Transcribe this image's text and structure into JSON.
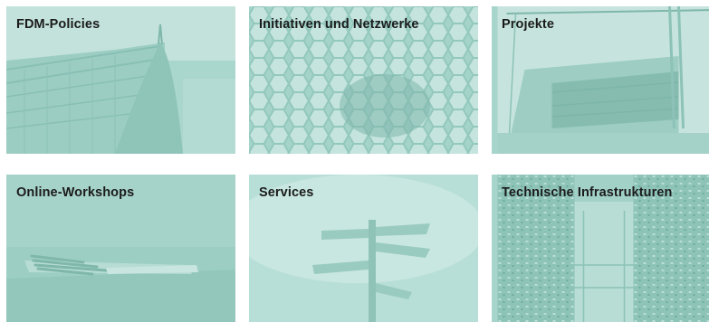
{
  "tiles": [
    {
      "title": "FDM-Policies",
      "image_icon": "bridge-photo"
    },
    {
      "title": "Initiativen und Netzwerke",
      "image_icon": "honeycomb-photo"
    },
    {
      "title": "Projekte",
      "image_icon": "construction-site-photo"
    },
    {
      "title": "Online-Workshops",
      "image_icon": "pencils-photo"
    },
    {
      "title": "Services",
      "image_icon": "signpost-photo"
    },
    {
      "title": "Technische Infrastrukturen",
      "image_icon": "server-room-photo"
    }
  ],
  "colors": {
    "tint": "#a7d5cc",
    "title_text": "#1b1b1b"
  }
}
